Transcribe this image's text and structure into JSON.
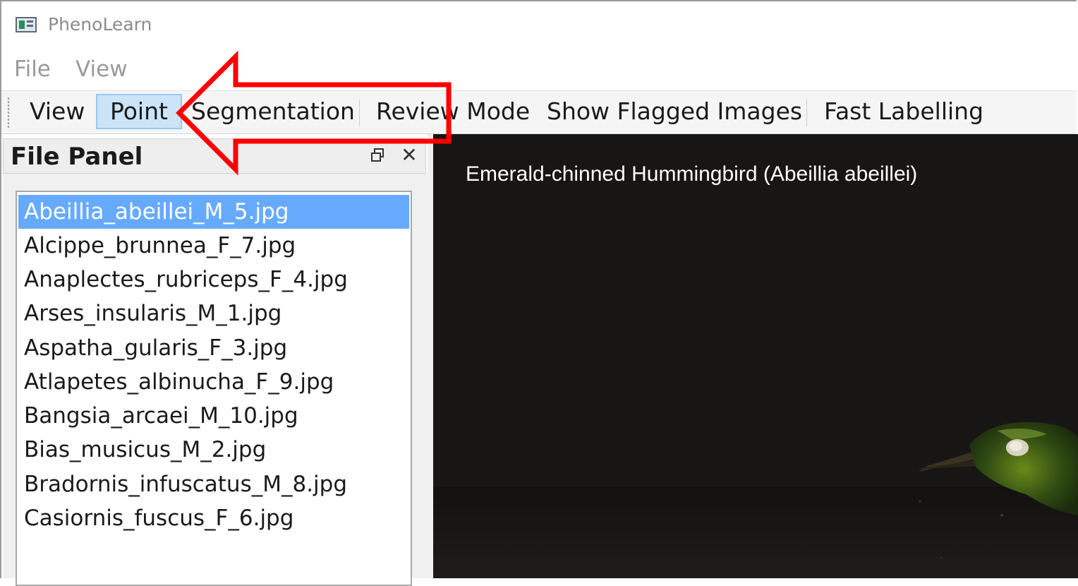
{
  "window": {
    "title": "PhenoLearn"
  },
  "menubar": {
    "items": [
      {
        "label": "File"
      },
      {
        "label": "View"
      }
    ]
  },
  "toolbar": {
    "buttons": [
      {
        "label": "View",
        "active": false
      },
      {
        "label": "Point",
        "active": true
      },
      {
        "label": "Segmentation",
        "active": false
      },
      {
        "label": "Review Mode",
        "active": false
      },
      {
        "label": "Show Flagged Images",
        "active": false
      },
      {
        "label": "Fast Labelling",
        "active": false
      }
    ]
  },
  "file_panel": {
    "title": "File Panel",
    "float_icon": "restore-icon",
    "close_icon": "close-icon",
    "close_glyph": "✕",
    "files": [
      {
        "name": "Abeillia_abeillei_M_5.jpg",
        "selected": true
      },
      {
        "name": "Alcippe_brunnea_F_7.jpg",
        "selected": false
      },
      {
        "name": "Anaplectes_rubriceps_F_4.jpg",
        "selected": false
      },
      {
        "name": "Arses_insularis_M_1.jpg",
        "selected": false
      },
      {
        "name": "Aspatha_gularis_F_3.jpg",
        "selected": false
      },
      {
        "name": "Atlapetes_albinucha_F_9.jpg",
        "selected": false
      },
      {
        "name": "Bangsia_arcaei_M_10.jpg",
        "selected": false
      },
      {
        "name": "Bias_musicus_M_2.jpg",
        "selected": false
      },
      {
        "name": "Bradornis_infuscatus_M_8.jpg",
        "selected": false
      },
      {
        "name": "Casiornis_fuscus_F_6.jpg",
        "selected": false
      }
    ]
  },
  "viewer": {
    "caption": "Emerald-chinned Hummingbird (Abeillia abeillei)",
    "background": "#171615"
  },
  "colors": {
    "selection": "#66aaff",
    "active_tool": "#cce4f7",
    "annotation_arrow": "#ff0000"
  }
}
